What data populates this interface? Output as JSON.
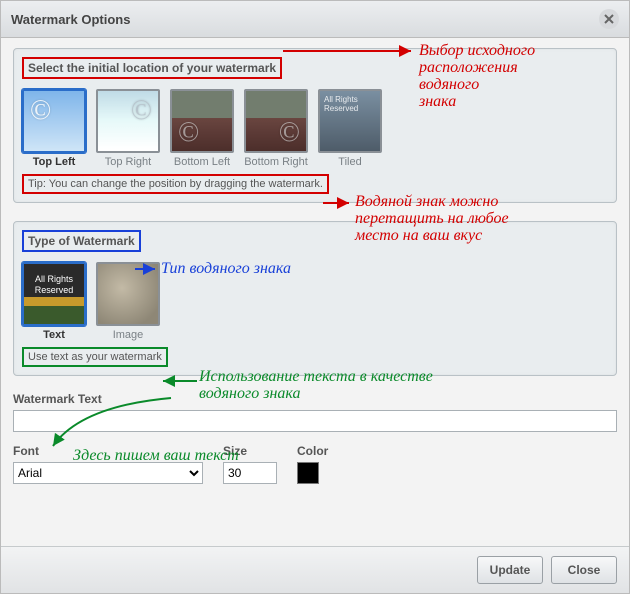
{
  "window": {
    "title": "Watermark Options"
  },
  "panel_location": {
    "heading": "Select the initial location of your watermark",
    "options": [
      {
        "label": "Top Left"
      },
      {
        "label": "Top Right"
      },
      {
        "label": "Bottom Left"
      },
      {
        "label": "Bottom Right"
      },
      {
        "label": "Tiled",
        "overlay": "All Rights Reserved"
      }
    ],
    "selected_index": 0,
    "tip": "Tip: You can change the position by dragging the watermark."
  },
  "panel_type": {
    "heading": "Type of Watermark",
    "options": [
      {
        "label": "Text",
        "overlay": "All\nRights\nReserved"
      },
      {
        "label": "Image"
      }
    ],
    "selected_index": 0,
    "tip": "Use text as your watermark"
  },
  "fields": {
    "text_label": "Watermark Text",
    "text_value": "",
    "font_label": "Font",
    "font_value": "Arial",
    "size_label": "Size",
    "size_value": "30",
    "color_label": "Color",
    "color_value": "#000000"
  },
  "buttons": {
    "update": "Update",
    "close": "Close"
  },
  "annotations": {
    "a1": "Выбор исходного\nрасположения\nводяного\nзнака",
    "a2": "Водяной знак можно\nперетащить на любое\nместо на ваш вкус",
    "a3": "Тип водяного знака",
    "a4": "Использование текста в качестве\nводяного знака",
    "a5": "Здесь пишем ваш текст"
  }
}
